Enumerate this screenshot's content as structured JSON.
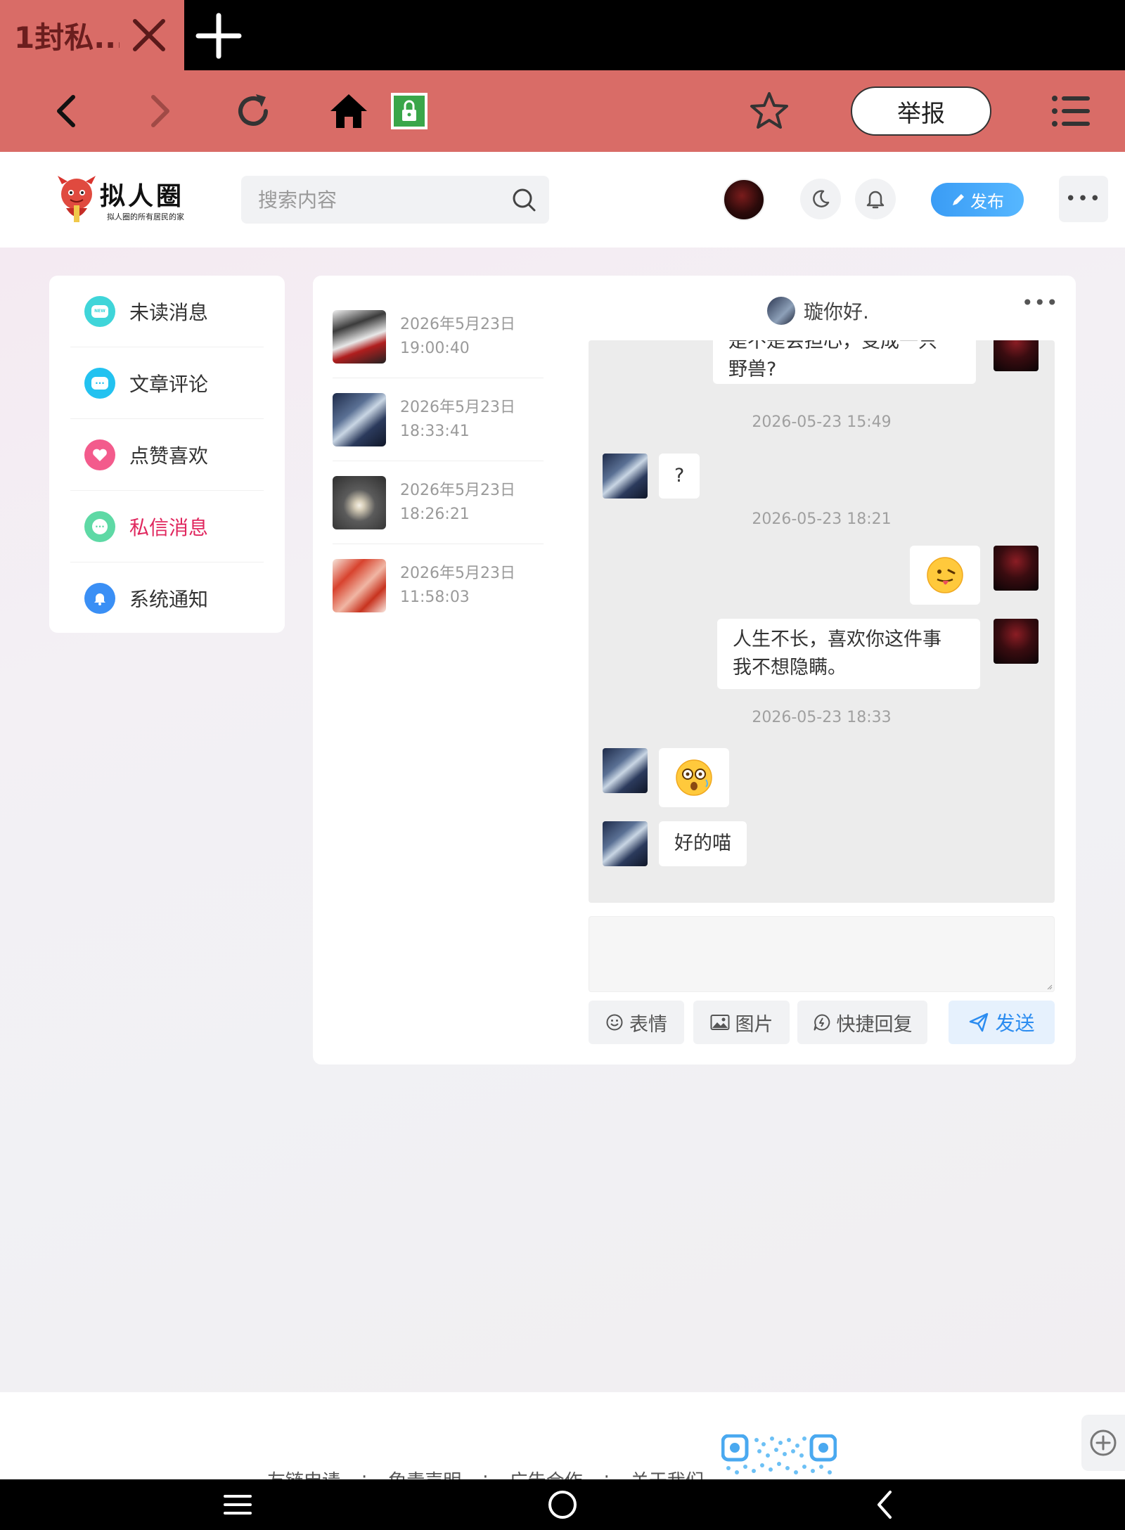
{
  "browser": {
    "tab_title": "1封私...",
    "report_label": "举报"
  },
  "site": {
    "logo_text": "拟人圈",
    "logo_sub": "拟人圈的所有居民的家",
    "search_placeholder": "搜索内容",
    "publish_label": "发布",
    "more_label": "•••"
  },
  "menu": {
    "items": [
      {
        "label": "未读消息",
        "badge": "NEW",
        "color": "#3fd5d9"
      },
      {
        "label": "文章评论",
        "badge": "···",
        "color": "#23c2f0"
      },
      {
        "label": "点赞喜欢",
        "badge": "♥",
        "color": "#f35b8c"
      },
      {
        "label": "私信消息",
        "badge": "···",
        "color": "#5ed9a5"
      },
      {
        "label": "系统通知",
        "badge": "🔔",
        "color": "#3a8ff5"
      }
    ],
    "active": "私信消息"
  },
  "conversations": [
    {
      "date": "2026年5月23日",
      "time": "19:00:40"
    },
    {
      "date": "2026年5月23日",
      "time": "18:33:41"
    },
    {
      "date": "2026年5月23日",
      "time": "18:26:21"
    },
    {
      "date": "2026年5月23日",
      "time": "11:58:03"
    }
  ],
  "chat": {
    "peer_name": "璇你好.",
    "more_label": "•••",
    "messages": {
      "m1_line1": "是不是会担心，变成一只",
      "m1_line2": "野兽?",
      "t1": "2026-05-23 15:49",
      "m2": "?",
      "t2": "2026-05-23 18:21",
      "m4_line1": "人生不长，喜欢你这件事",
      "m4_line2": "我不想隐瞒。",
      "t3": "2026-05-23 18:33",
      "m6": "好的喵"
    }
  },
  "compose": {
    "emoji_label": "表情",
    "image_label": "图片",
    "quick_reply_label": "快捷回复",
    "send_label": "发送"
  },
  "footer": {
    "links": [
      "友链申请",
      "免责声明",
      "广告合作",
      "关于我们"
    ]
  },
  "colors": {
    "browser_accent": "#d96c67",
    "active_menu": "#e0275e",
    "send_blue": "#2b8cf0"
  }
}
